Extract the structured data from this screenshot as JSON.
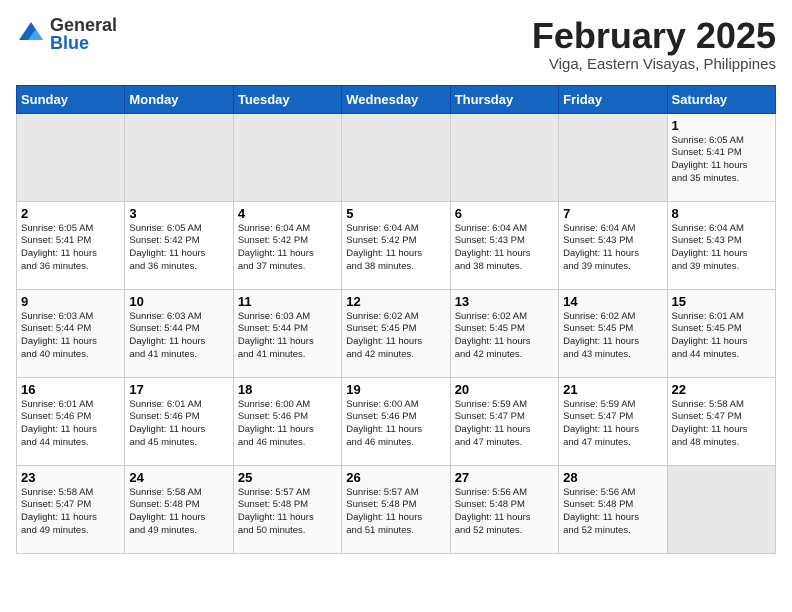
{
  "logo": {
    "general": "General",
    "blue": "Blue"
  },
  "header": {
    "month_year": "February 2025",
    "location": "Viga, Eastern Visayas, Philippines"
  },
  "weekdays": [
    "Sunday",
    "Monday",
    "Tuesday",
    "Wednesday",
    "Thursday",
    "Friday",
    "Saturday"
  ],
  "weeks": [
    [
      {
        "day": "",
        "info": ""
      },
      {
        "day": "",
        "info": ""
      },
      {
        "day": "",
        "info": ""
      },
      {
        "day": "",
        "info": ""
      },
      {
        "day": "",
        "info": ""
      },
      {
        "day": "",
        "info": ""
      },
      {
        "day": "1",
        "info": "Sunrise: 6:05 AM\nSunset: 5:41 PM\nDaylight: 11 hours\nand 35 minutes."
      }
    ],
    [
      {
        "day": "2",
        "info": "Sunrise: 6:05 AM\nSunset: 5:41 PM\nDaylight: 11 hours\nand 36 minutes."
      },
      {
        "day": "3",
        "info": "Sunrise: 6:05 AM\nSunset: 5:42 PM\nDaylight: 11 hours\nand 36 minutes."
      },
      {
        "day": "4",
        "info": "Sunrise: 6:04 AM\nSunset: 5:42 PM\nDaylight: 11 hours\nand 37 minutes."
      },
      {
        "day": "5",
        "info": "Sunrise: 6:04 AM\nSunset: 5:42 PM\nDaylight: 11 hours\nand 38 minutes."
      },
      {
        "day": "6",
        "info": "Sunrise: 6:04 AM\nSunset: 5:43 PM\nDaylight: 11 hours\nand 38 minutes."
      },
      {
        "day": "7",
        "info": "Sunrise: 6:04 AM\nSunset: 5:43 PM\nDaylight: 11 hours\nand 39 minutes."
      },
      {
        "day": "8",
        "info": "Sunrise: 6:04 AM\nSunset: 5:43 PM\nDaylight: 11 hours\nand 39 minutes."
      }
    ],
    [
      {
        "day": "9",
        "info": "Sunrise: 6:03 AM\nSunset: 5:44 PM\nDaylight: 11 hours\nand 40 minutes."
      },
      {
        "day": "10",
        "info": "Sunrise: 6:03 AM\nSunset: 5:44 PM\nDaylight: 11 hours\nand 41 minutes."
      },
      {
        "day": "11",
        "info": "Sunrise: 6:03 AM\nSunset: 5:44 PM\nDaylight: 11 hours\nand 41 minutes."
      },
      {
        "day": "12",
        "info": "Sunrise: 6:02 AM\nSunset: 5:45 PM\nDaylight: 11 hours\nand 42 minutes."
      },
      {
        "day": "13",
        "info": "Sunrise: 6:02 AM\nSunset: 5:45 PM\nDaylight: 11 hours\nand 42 minutes."
      },
      {
        "day": "14",
        "info": "Sunrise: 6:02 AM\nSunset: 5:45 PM\nDaylight: 11 hours\nand 43 minutes."
      },
      {
        "day": "15",
        "info": "Sunrise: 6:01 AM\nSunset: 5:45 PM\nDaylight: 11 hours\nand 44 minutes."
      }
    ],
    [
      {
        "day": "16",
        "info": "Sunrise: 6:01 AM\nSunset: 5:46 PM\nDaylight: 11 hours\nand 44 minutes."
      },
      {
        "day": "17",
        "info": "Sunrise: 6:01 AM\nSunset: 5:46 PM\nDaylight: 11 hours\nand 45 minutes."
      },
      {
        "day": "18",
        "info": "Sunrise: 6:00 AM\nSunset: 5:46 PM\nDaylight: 11 hours\nand 46 minutes."
      },
      {
        "day": "19",
        "info": "Sunrise: 6:00 AM\nSunset: 5:46 PM\nDaylight: 11 hours\nand 46 minutes."
      },
      {
        "day": "20",
        "info": "Sunrise: 5:59 AM\nSunset: 5:47 PM\nDaylight: 11 hours\nand 47 minutes."
      },
      {
        "day": "21",
        "info": "Sunrise: 5:59 AM\nSunset: 5:47 PM\nDaylight: 11 hours\nand 47 minutes."
      },
      {
        "day": "22",
        "info": "Sunrise: 5:58 AM\nSunset: 5:47 PM\nDaylight: 11 hours\nand 48 minutes."
      }
    ],
    [
      {
        "day": "23",
        "info": "Sunrise: 5:58 AM\nSunset: 5:47 PM\nDaylight: 11 hours\nand 49 minutes."
      },
      {
        "day": "24",
        "info": "Sunrise: 5:58 AM\nSunset: 5:48 PM\nDaylight: 11 hours\nand 49 minutes."
      },
      {
        "day": "25",
        "info": "Sunrise: 5:57 AM\nSunset: 5:48 PM\nDaylight: 11 hours\nand 50 minutes."
      },
      {
        "day": "26",
        "info": "Sunrise: 5:57 AM\nSunset: 5:48 PM\nDaylight: 11 hours\nand 51 minutes."
      },
      {
        "day": "27",
        "info": "Sunrise: 5:56 AM\nSunset: 5:48 PM\nDaylight: 11 hours\nand 52 minutes."
      },
      {
        "day": "28",
        "info": "Sunrise: 5:56 AM\nSunset: 5:48 PM\nDaylight: 11 hours\nand 52 minutes."
      },
      {
        "day": "",
        "info": ""
      }
    ]
  ]
}
